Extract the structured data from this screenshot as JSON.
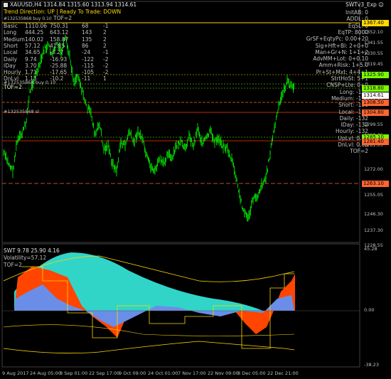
{
  "window": {
    "title": "XAUUSD,H4  1314.84 1315.60 1313.94 1314.61",
    "expert": "SWTv3_Exp",
    "status": "Trend Direction:  UP  |  Ready To Trade:  DOWN",
    "tof_line": "TOF=2"
  },
  "left_stats": {
    "header": [
      "Basic",
      "1110.06",
      "750.31",
      "68",
      "-1"
    ],
    "rows": [
      [
        "Basic",
        "1110.06",
        "750.31",
        "68",
        "-1"
      ],
      [
        "Long",
        "444.25",
        "643.12",
        "143",
        "2"
      ],
      [
        "Medium",
        "140.02",
        "158.87",
        "135",
        "2"
      ],
      [
        "Short",
        "57.12",
        "41.85",
        "86",
        "2"
      ],
      [
        "Local",
        "34.65",
        "-3.27",
        "-24",
        "-1"
      ],
      [
        "Daily",
        "9.74",
        "-16.93",
        "-122",
        "-2"
      ],
      [
        "IDay",
        "3.70",
        "-25.88",
        "-115",
        "-2"
      ],
      [
        "Hourly",
        "1.71",
        "-17.65",
        "-105",
        "-2"
      ],
      [
        "DnLvl",
        "1.13",
        "-10.2",
        "-11",
        "1"
      ]
    ],
    "tof": "TOF=2"
  },
  "right_stats": {
    "rows": [
      [
        "InitAB:",
        "0"
      ],
      [
        "ADDL:",
        "0"
      ],
      [
        "EqSL:",
        "0"
      ],
      [
        "EqTP:",
        "8000"
      ],
      [
        "GrSF+EqtyPc:",
        "0.00+20"
      ],
      [
        "Sig+Hft+Bl:",
        "2+0+0"
      ],
      [
        "Man+Gr+N:",
        "1+1+2"
      ],
      [
        "AdvMM+Lot:",
        "0+0.10"
      ],
      [
        "Amm+Risk:",
        "1+5.0"
      ],
      [
        "Pr+St+Mxt:",
        "4+4+1"
      ],
      [
        "StrtHoSt:",
        "5+1"
      ],
      [
        "CNSP+Lte:",
        "0+0"
      ],
      [
        "Long:",
        "-130"
      ],
      [
        "Medium:",
        "-132"
      ],
      [
        "Short:",
        "-130"
      ],
      [
        "Local:",
        "-130"
      ],
      [
        "Daily:",
        "-132"
      ],
      [
        "IDay:",
        "-132"
      ],
      [
        "Hourly:",
        "-132"
      ],
      [
        "UpLvl:",
        "0.00"
      ],
      [
        "DnLvl:",
        "0.00"
      ],
      [
        "TOF",
        "TOF=2"
      ]
    ]
  },
  "orders": {
    "order1": "#132535868 buy 0.10",
    "order2": "#132535868 buy 0.10",
    "order3": "#132535868 sl"
  },
  "price_axis": [
    "1367.40",
    "1352.10",
    "1341.55",
    "1330.55",
    "1319.45",
    "1308.30",
    "1299.55",
    "1290.35",
    "1281.05",
    "1272.00",
    "1263.10",
    "1255.05",
    "1246.30",
    "1237.30",
    "1228.55"
  ],
  "price_tags": [
    {
      "label": "1367.40",
      "color": "#ffd700"
    },
    {
      "label": "1325.90",
      "color": "#7cfc00"
    },
    {
      "label": "1318.80",
      "color": "#7cfc00"
    },
    {
      "label": "1314.61",
      "color": "#ffffff"
    },
    {
      "label": "1308.50",
      "color": "#ff6633"
    },
    {
      "label": "1304.80",
      "color": "#ff6633"
    },
    {
      "label": "1285.10",
      "color": "#7cfc00"
    },
    {
      "label": "1281.40",
      "color": "#ff6633"
    },
    {
      "label": "1263.10",
      "color": "#ff6633"
    }
  ],
  "indicator": {
    "title": "SWT 9.78 25.90 4.16",
    "volatility": "Volatility=57.12",
    "tof": "TOF=2",
    "axis_top": "45.28",
    "axis_mid": "0.00",
    "axis_bottom": "-38.23"
  },
  "x_axis": [
    "9 Aug 2017",
    "24 Aug 05:00",
    "8 Sep 01:00",
    "22 Sep 17:00",
    "9 Oct 09:00",
    "24 Oct 01:00",
    "7 Nov 17:00",
    "22 Nov 09:00",
    "8 Dec 05:00",
    "22 Dec 21:00"
  ],
  "colors": {
    "background": "#000000",
    "candles": "#00ff00",
    "level_yellow": "#ffd700",
    "level_red": "#ff3300",
    "level_green": "#7cfc00",
    "osc_cyan": "#30d5c8",
    "osc_orange": "#ff4500",
    "osc_blue": "#6a8ee8",
    "osc_yellow": "#ffd700"
  }
}
